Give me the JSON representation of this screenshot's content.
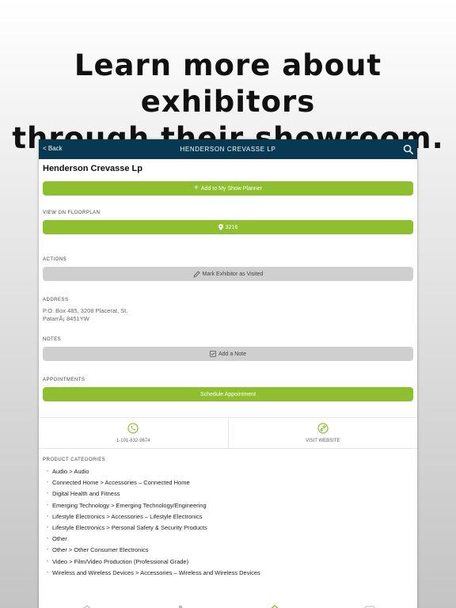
{
  "headline": {
    "line1": "Learn more about exhibitors",
    "line2": "through their showroom."
  },
  "navbar": {
    "back_label": "< Back",
    "title": "HENDERSON CREVASSE LP"
  },
  "exhibitor": {
    "name": "Henderson Crevasse Lp"
  },
  "planner": {
    "button_label": "Add to My Show Planner"
  },
  "floorplan": {
    "section_label": "VIEW ON FLOORPLAN",
    "booth": "3216"
  },
  "actions": {
    "section_label": "ACTIONS",
    "visited_label": "Mark Exhibitor as Visited"
  },
  "address": {
    "section_label": "ADDRESS",
    "line1": "P.O. Box 485, 3208 Placerat, St.",
    "line2": "PatarrÃ¡ 8451YW"
  },
  "notes": {
    "section_label": "NOTES",
    "add_label": "Add a Note"
  },
  "appointments": {
    "section_label": "APPOINTMENTS",
    "schedule_label": "Schedule Appointment"
  },
  "contact": {
    "phone": "1-101-632-9674",
    "website_label": "VISIT WEBSITE"
  },
  "categories": {
    "section_label": "PRODUCT CATEGORIES",
    "items": [
      "Audio > Audio",
      "Connected Home > Accessories – Connected Home",
      "Digital Health and Fitness",
      "Emerging Technology > Emerging Technology/Engineering",
      "Lifestyle Electronics > Accessories – Lifestyle Electronics",
      "Lifestyle Electronics > Personal Safety & Security Products",
      "Other",
      "Other > Other Consumer Electronics",
      "Video > Film/Video Production (Professional Grade)",
      "Wireless and Wireless Devices > Accessories – Wireless and Wireless Devices"
    ]
  },
  "colors": {
    "navbar": "#073a52",
    "accent_green": "#8dc02c",
    "button_gray": "#cfcfcf"
  },
  "icons": [
    "search-icon",
    "plus-icon",
    "map-pin-icon",
    "pencil-icon",
    "note-icon",
    "phone-icon",
    "link-icon",
    "home-tab-icon",
    "people-tab-icon",
    "showroom-tab-icon",
    "more-tab-icon"
  ]
}
